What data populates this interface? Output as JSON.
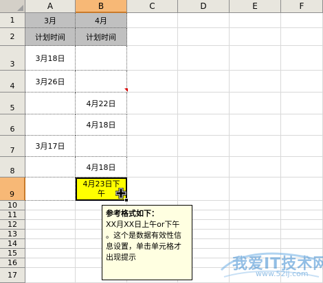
{
  "columns": [
    "A",
    "B",
    "C",
    "D",
    "E",
    "F"
  ],
  "rows": [
    "1",
    "2",
    "3",
    "4",
    "5",
    "6",
    "7",
    "8",
    "9",
    "10",
    "11",
    "12",
    "13",
    "14",
    "15",
    "16",
    "17"
  ],
  "cells": {
    "A1": "3月",
    "B1": "4月",
    "A2": "计划时间",
    "B2": "计划时间",
    "A3": "3月18日",
    "A4": "3月26日",
    "B5": "4月22日",
    "B6": "4月18日",
    "A7": "3月17日",
    "B8": "4月18日"
  },
  "selected_cell": {
    "ref": "B9",
    "line1": "4月23日下",
    "line2": "午"
  },
  "validation_tooltip": {
    "title": "参考格式如下：",
    "line1": "XX月XX日上午or下午",
    "line2": "。这个是数据有效性信",
    "line3": "息设置，单击单元格才",
    "line4": "出现提示"
  },
  "watermark": {
    "text": "我爱IT技术网",
    "url": "www.52ij.com"
  },
  "colors": {
    "selected_fill": "#ffff00",
    "header_fill": "#c0c0c0",
    "active_header": "#f7b876",
    "tooltip_bg": "#ffffe1"
  }
}
